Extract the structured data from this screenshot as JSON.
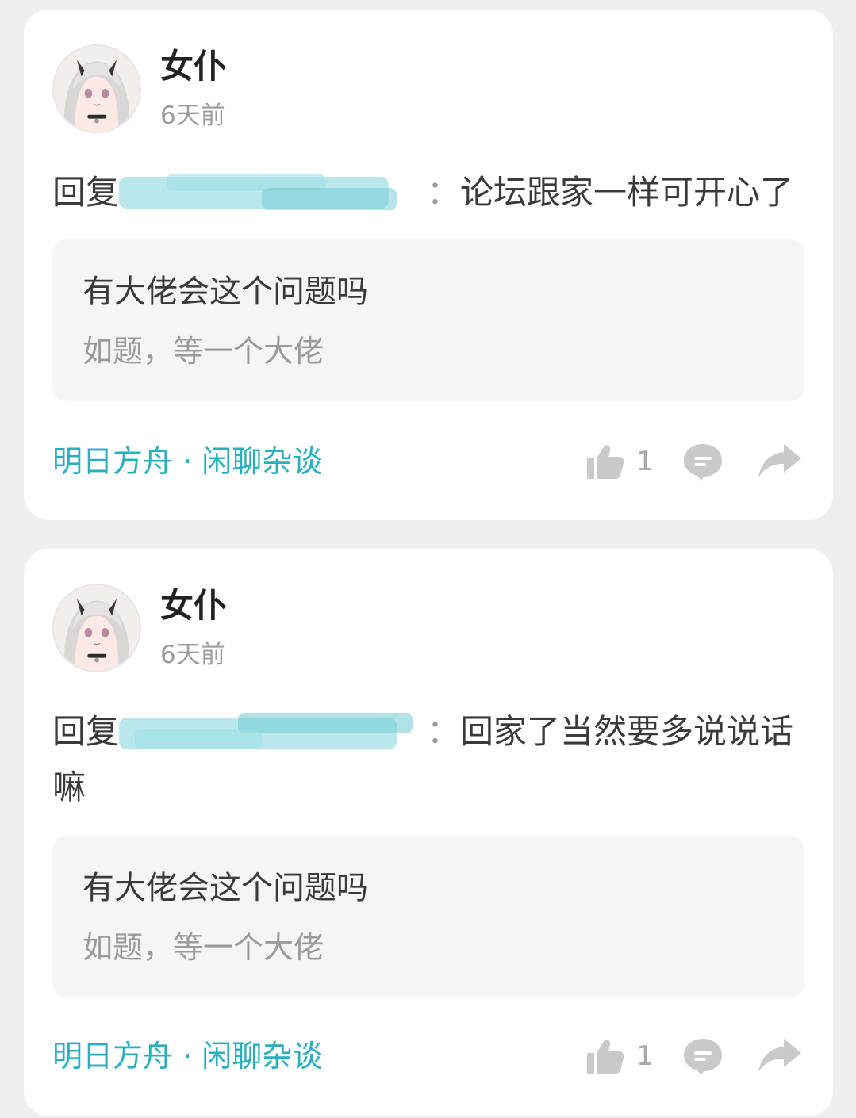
{
  "posts": [
    {
      "username": "女仆",
      "timestamp": "6天前",
      "reply_prefix": "回复",
      "reply_separator": "：",
      "reply_text": "论坛跟家一样可开心了",
      "quote": {
        "title": "有大佬会这个问题吗",
        "body": "如题，等一个大佬"
      },
      "forum": "明日方舟 · 闲聊杂谈",
      "like_count": "1"
    },
    {
      "username": "女仆",
      "timestamp": "6天前",
      "reply_prefix": "回复",
      "reply_separator": "：",
      "reply_text": "回家了当然要多说说话嘛",
      "quote": {
        "title": "有大佬会这个问题吗",
        "body": "如题，等一个大佬"
      },
      "forum": "明日方舟 · 闲聊杂谈",
      "like_count": "1"
    }
  ],
  "icons": {
    "avatar": "anime-avatar",
    "like": "thumbs-up-icon",
    "comment": "comment-bubble-icon",
    "share": "share-arrow-icon"
  },
  "colors": {
    "accent": "#2ab0bc",
    "redaction": "#7fd3dc",
    "icon_gray": "#c9c9c9"
  }
}
